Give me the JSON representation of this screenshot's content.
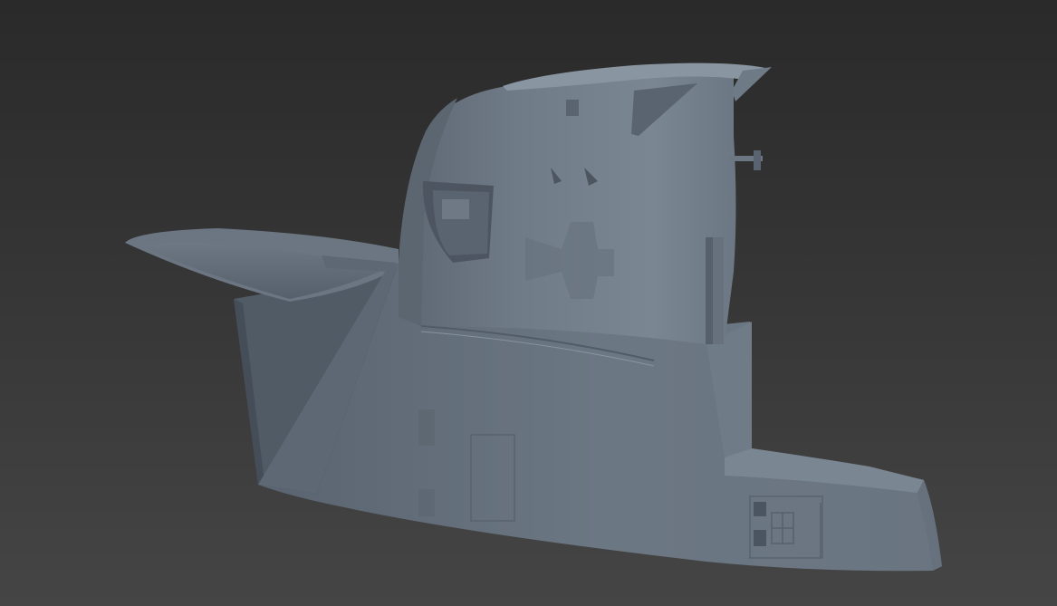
{
  "scene": {
    "subject": "submarine-conning-tower-3d-model",
    "colors": {
      "background_top": "#2a2a2a",
      "background_bottom": "#454545",
      "hull_light": "#7a8592",
      "hull_mid": "#6a7582",
      "hull_dark": "#4f5964",
      "hull_shadow": "#3f4851",
      "detail_line": "#525c67"
    }
  }
}
